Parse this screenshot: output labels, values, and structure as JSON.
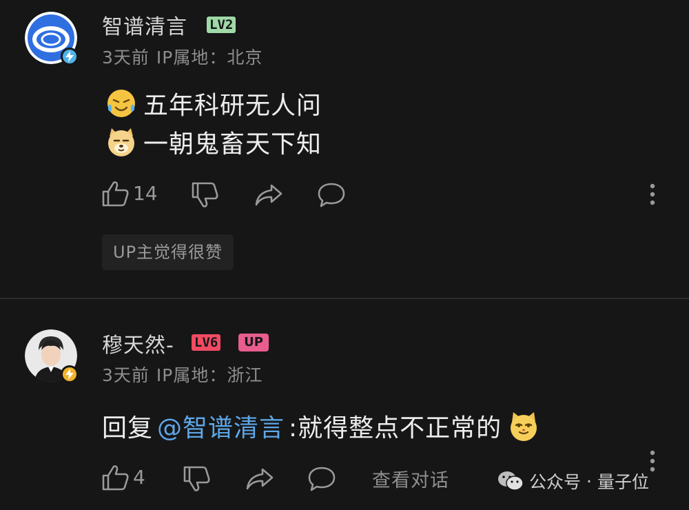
{
  "comments": [
    {
      "username": "智谱清言",
      "level": "LV2",
      "time": "3天前",
      "ip_label": "IP属地：北京",
      "lines": [
        "五年科研无人问",
        "一朝鬼畜天下知"
      ],
      "line_emojis": [
        "crying-laugh-emoji",
        "doge-emoji"
      ],
      "likes": "14",
      "up_liked": "UP主觉得很赞",
      "colors": {
        "level": "#9fd9a8",
        "avatar": "#2f6fe0"
      }
    },
    {
      "username": "穆天然-",
      "level": "LV6",
      "up_badge": "UP",
      "time": "3天前",
      "ip_label": "IP属地：浙江",
      "reply_prefix": "回复",
      "mention": "@智谱清言",
      "reply_text": ":就得整点不正常的",
      "reply_emoji": "cat-smirk-emoji",
      "likes": "4",
      "view_conversation": "查看对话",
      "colors": {
        "level": "#f04b63",
        "up_badge": "#e85d8e"
      }
    }
  ],
  "watermark": {
    "source": "公众号",
    "sep": "·",
    "name": "量子位",
    "icon": "wechat-icon"
  }
}
